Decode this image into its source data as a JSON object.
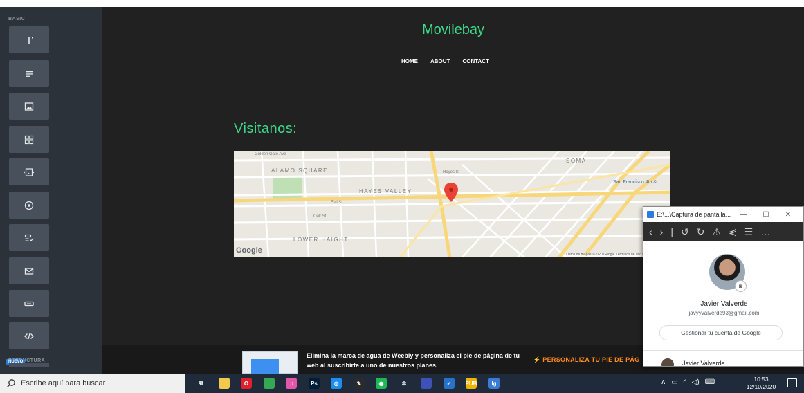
{
  "sidebar": {
    "section_basic": "BASIC",
    "section_structure": "ESTRUCTURA",
    "new_badge": "NUEVO",
    "tools": [
      {
        "icon": "text-icon"
      },
      {
        "icon": "paragraph-icon"
      },
      {
        "icon": "image-icon"
      },
      {
        "icon": "gallery-icon"
      },
      {
        "icon": "slideshow-icon"
      },
      {
        "icon": "map-pin-icon"
      },
      {
        "icon": "form-icon"
      },
      {
        "icon": "mail-icon"
      },
      {
        "icon": "button-icon"
      },
      {
        "icon": "code-icon"
      }
    ]
  },
  "site": {
    "title": "Movilebay",
    "nav": [
      "HOME",
      "ABOUT",
      "CONTACT"
    ],
    "section_heading": "Visitanos:"
  },
  "map": {
    "labels": {
      "alamo_square": "ALAMO SQUARE",
      "hayes_valley": "HAYES VALLEY",
      "lower_haight": "LOWER HAIGHT",
      "soma": "SOMA",
      "san_francisco": "San Francisco 4th &",
      "golden_gate": "Golden Gate Ave",
      "fell_st": "Fell St",
      "oak_st": "Oak St",
      "hayes_st": "Hayes St"
    },
    "google_logo": "Google",
    "attribution": "Datos de mapas ©2020 Google   Términos de uso   Notificar un prob"
  },
  "footer": {
    "promo_text": "Elimina la marca de agua de Weebly y personaliza el pie de página de tu web al suscribirte a uno de nuestros planes.",
    "cta": "⚡ PERSONALIZA TU PIE DE PÁG"
  },
  "popup": {
    "window_title": "E:\\...\\Captura de pantalla...",
    "minimize": "—",
    "maximize": "☐",
    "close": "✕",
    "toolbar": [
      "‹",
      "›",
      "|",
      "↺",
      "↻",
      "⚠",
      "⋞",
      "☰",
      "…"
    ],
    "user_name": "Javier Valverde",
    "user_email": "javyyvalverde93@gmail.com",
    "manage_button": "Gestionar tu cuenta de Google",
    "account_name": "Javier Valverde"
  },
  "taskbar": {
    "search_placeholder": "Escribe aquí para buscar",
    "time": "10:53",
    "date": "12/10/2020",
    "apps": [
      {
        "name": "task-view-icon",
        "label": "⧉",
        "color": "#1f2b3a"
      },
      {
        "name": "file-explorer-icon",
        "label": "",
        "color": "#f2c94c"
      },
      {
        "name": "opera-icon",
        "label": "O",
        "color": "#e0202a"
      },
      {
        "name": "chrome-icon",
        "label": "",
        "color": "#34a853"
      },
      {
        "name": "itunes-icon",
        "label": "♫",
        "color": "#e457a8"
      },
      {
        "name": "photoshop-icon",
        "label": "Ps",
        "color": "#001e36"
      },
      {
        "name": "instagram-icon",
        "label": "◎",
        "color": "#1d8ef0"
      },
      {
        "name": "inkscape-icon",
        "label": "✎",
        "color": "#2b2b2b"
      },
      {
        "name": "spotify-icon",
        "label": "◉",
        "color": "#1db954"
      },
      {
        "name": "settings-icon",
        "label": "✲",
        "color": "#1f2b3a"
      },
      {
        "name": "app-blue-icon",
        "label": "",
        "color": "#3f51b5"
      },
      {
        "name": "shield-app-icon",
        "label": "✓",
        "color": "#2872c9"
      },
      {
        "name": "pubg-icon",
        "label": "PUB",
        "color": "#f0b400"
      },
      {
        "name": "image-viewer-icon",
        "label": "lg",
        "color": "#3a7bd5"
      }
    ]
  }
}
